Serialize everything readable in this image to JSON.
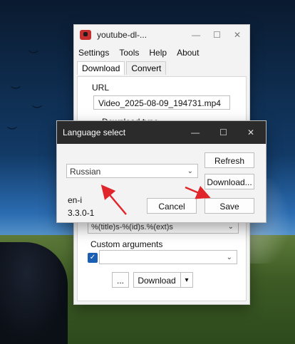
{
  "main_window": {
    "title": "youtube-dl-...",
    "controls": [
      "—",
      "☐",
      "✕"
    ],
    "menu": [
      "Settings",
      "Tools",
      "Help",
      "About"
    ],
    "tabs": [
      "Download",
      "Convert"
    ],
    "url_label": "URL",
    "url_value": "Video_2025-08-09_194731.mp4",
    "download_type_label": "Download type",
    "filename_template_value": "%(title)s-%(id)s.%(ext)s",
    "custom_args_label": "Custom arguments",
    "custom_args_value": "",
    "ellipsis_button": "...",
    "download_button": "Download",
    "download_dropdown_arrow": "▾"
  },
  "language_dialog": {
    "title": "Language select",
    "controls": [
      "—",
      "☐",
      "✕"
    ],
    "language_value": "Russian",
    "refresh_button": "Refresh",
    "download_button": "Download...",
    "locale_code": "en-i",
    "version": "3.3.0-1",
    "cancel_button": "Cancel",
    "save_button": "Save"
  },
  "icons": {
    "app_icon": "app-icon",
    "dropdown_icon": "chevron-down-icon",
    "checkbox_checked_icon": "checkmark-icon"
  },
  "colors": {
    "annotation_arrow": "#e0262b",
    "checkbox_accent": "#1a5fb4",
    "dialog_titlebar": "#2b2b2b"
  }
}
